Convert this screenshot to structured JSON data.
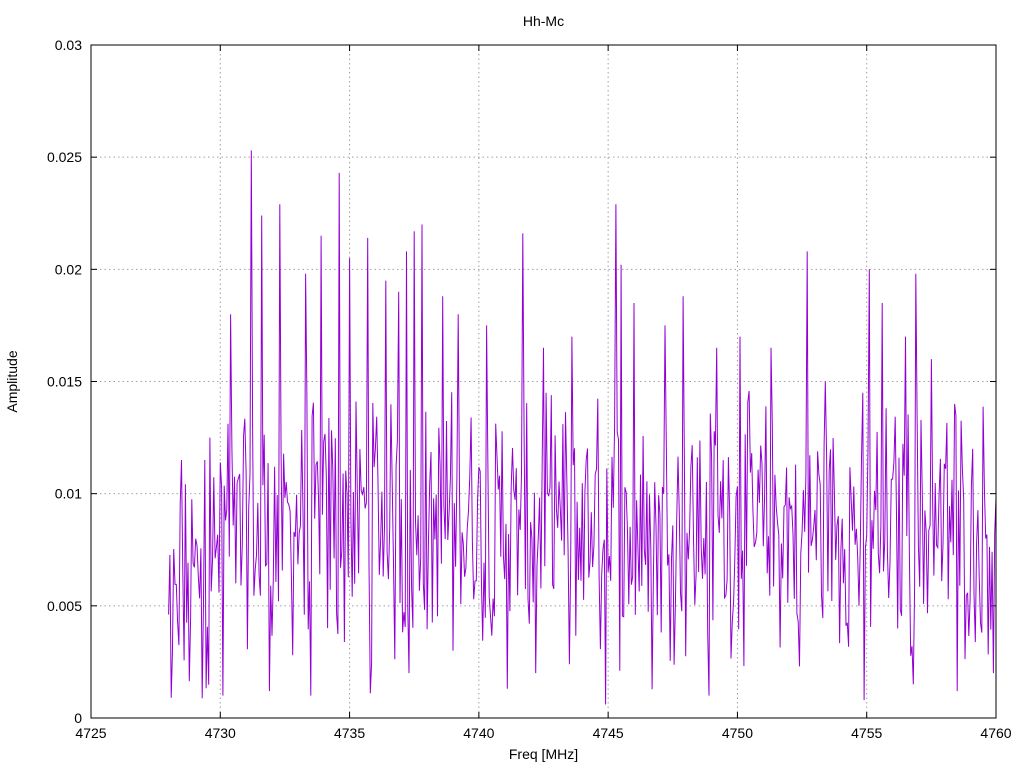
{
  "chart_data": {
    "type": "line",
    "title": "Hh-Mc",
    "xlabel": "Freq [MHz]",
    "ylabel": "Amplitude",
    "xlim": [
      4725,
      4760
    ],
    "ylim": [
      0,
      0.03
    ],
    "xticks": [
      4725,
      4730,
      4735,
      4740,
      4745,
      4750,
      4755,
      4760
    ],
    "yticks": [
      0,
      0.005,
      0.01,
      0.015,
      0.02,
      0.025,
      0.03
    ],
    "xtick_labels": [
      "4725",
      "4730",
      "4735",
      "4740",
      "4745",
      "4750",
      "4755",
      "4760"
    ],
    "ytick_labels": [
      "0",
      "0.005",
      "0.01",
      "0.015",
      "0.02",
      "0.025",
      "0.03"
    ],
    "grid": true,
    "color": "#9400d3",
    "series": [
      {
        "x_start": 4728.0,
        "x_step": 0.05,
        "peaks": [
          [
            4728.5,
            0.0115
          ],
          [
            4729.4,
            0.0115
          ],
          [
            4729.6,
            0.0125
          ],
          [
            4730.1,
            0.0148
          ],
          [
            4730.4,
            0.018
          ],
          [
            4731.2,
            0.0253
          ],
          [
            4731.6,
            0.0224
          ],
          [
            4732.3,
            0.0229
          ],
          [
            4733.3,
            0.0198
          ],
          [
            4733.9,
            0.0215
          ],
          [
            4734.6,
            0.0243
          ],
          [
            4735.0,
            0.0205
          ],
          [
            4735.7,
            0.0214
          ],
          [
            4736.4,
            0.0195
          ],
          [
            4736.9,
            0.019
          ],
          [
            4737.2,
            0.0208
          ],
          [
            4737.5,
            0.0217
          ],
          [
            4737.8,
            0.022
          ],
          [
            4738.6,
            0.0188
          ],
          [
            4739.2,
            0.018
          ],
          [
            4740.3,
            0.0175
          ],
          [
            4741.7,
            0.0216
          ],
          [
            4742.5,
            0.0165
          ],
          [
            4743.6,
            0.017
          ],
          [
            4745.3,
            0.0229
          ],
          [
            4745.5,
            0.0202
          ],
          [
            4746.0,
            0.0185
          ],
          [
            4747.2,
            0.0175
          ],
          [
            4747.9,
            0.0188
          ],
          [
            4749.2,
            0.0165
          ],
          [
            4750.1,
            0.017
          ],
          [
            4751.3,
            0.0165
          ],
          [
            4752.7,
            0.0208
          ],
          [
            4753.4,
            0.015
          ],
          [
            4755.1,
            0.02
          ],
          [
            4755.6,
            0.0185
          ],
          [
            4756.5,
            0.017
          ],
          [
            4756.9,
            0.0198
          ],
          [
            4757.5,
            0.016
          ],
          [
            4758.4,
            0.014
          ],
          [
            4759.1,
            0.012
          ],
          [
            4759.6,
            0.008
          ]
        ],
        "troughs": [
          [
            4728.1,
            0.0009
          ],
          [
            4729.3,
            0.0002
          ],
          [
            4730.1,
            0.001
          ],
          [
            4731.9,
            0.0012
          ],
          [
            4733.5,
            0.001
          ],
          [
            4735.8,
            0.0011
          ],
          [
            4737.3,
            0.002
          ],
          [
            4739.0,
            0.003
          ],
          [
            4741.1,
            0.0013
          ],
          [
            4742.2,
            0.002
          ],
          [
            4743.5,
            0.0024
          ],
          [
            4744.9,
            0.0006
          ],
          [
            4746.7,
            0.0004
          ],
          [
            4748.9,
            0.001
          ],
          [
            4752.4,
            0.0023
          ],
          [
            4754.9,
            0.0008
          ],
          [
            4756.8,
            0.0015
          ],
          [
            4758.5,
            0.0012
          ],
          [
            4759.9,
            0.002
          ]
        ]
      }
    ]
  }
}
